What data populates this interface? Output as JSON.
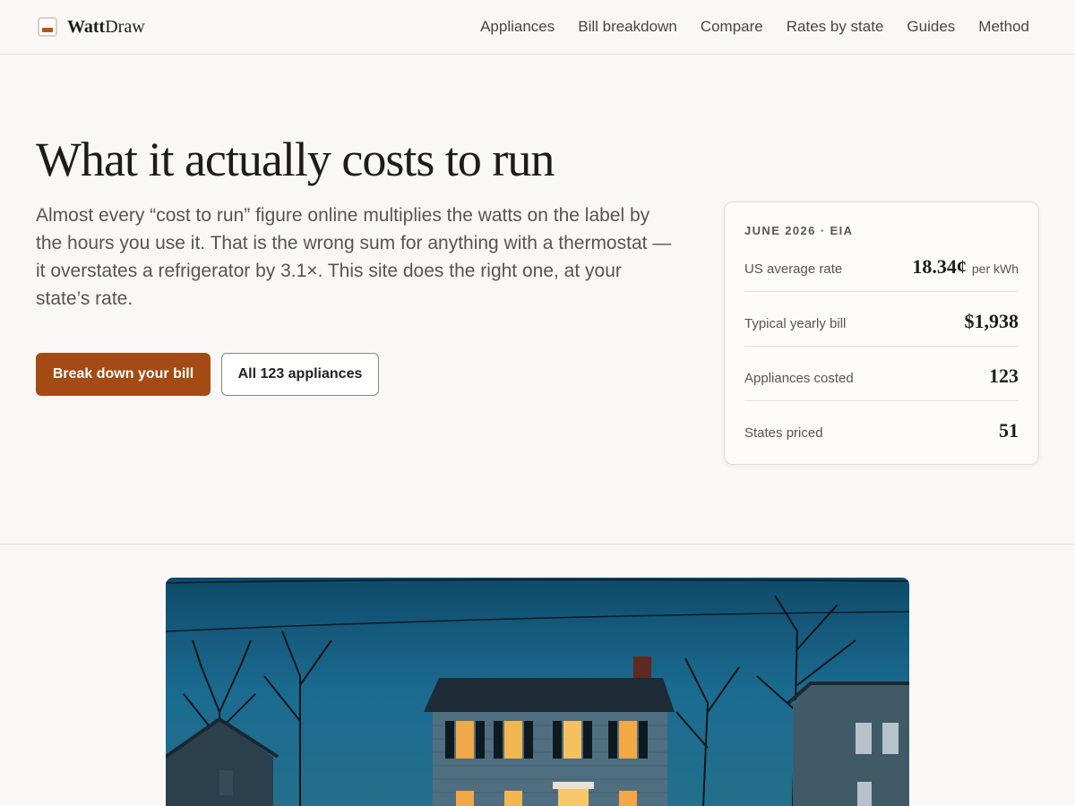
{
  "brand": {
    "name_bold": "Watt",
    "name_rest": "Draw"
  },
  "nav": {
    "items": [
      {
        "label": "Appliances"
      },
      {
        "label": "Bill breakdown"
      },
      {
        "label": "Compare"
      },
      {
        "label": "Rates by state"
      },
      {
        "label": "Guides"
      },
      {
        "label": "Method"
      }
    ]
  },
  "hero": {
    "title": "What it actually costs to run",
    "lede": "Almost every “cost to run” figure online multiplies the watts on the label by the hours you use it. That is the wrong sum for anything with a thermostat — it overstates a refrigerator by 3.1×. This site does the right one, at your state’s rate.",
    "primary_cta": "Break down your bill",
    "secondary_cta": "All 123 appliances"
  },
  "stats": {
    "kicker": "JUNE 2026 · EIA",
    "rows": [
      {
        "label": "US average rate",
        "value": "18.34¢",
        "unit": "per kWh"
      },
      {
        "label": "Typical yearly bill",
        "value": "$1,938",
        "unit": ""
      },
      {
        "label": "Appliances costed",
        "value": "123",
        "unit": ""
      },
      {
        "label": "States priced",
        "value": "51",
        "unit": ""
      }
    ]
  },
  "colors": {
    "accent": "#a44a14",
    "background": "#faf8f6",
    "photo_sky": "#1b5d80"
  },
  "icons": {
    "logo": "meter-icon"
  }
}
